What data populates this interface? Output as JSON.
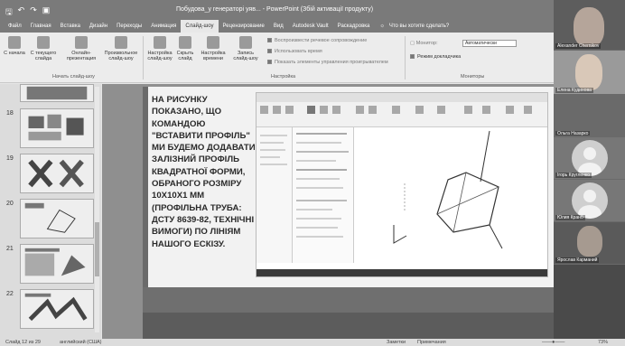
{
  "window": {
    "title": "Побудова_у генераторі уяв... - PowerPoint (Збій активації продукту)"
  },
  "tabs": [
    "Файл",
    "Главная",
    "Вставка",
    "Дизайн",
    "Переходы",
    "Анимация",
    "Слайд-шоу",
    "Рецензирование",
    "Вид",
    "Autodesk Vault",
    "Раскадровка"
  ],
  "active_tab": "Слайд-шоу",
  "help_text": "Что вы хотите сделать?",
  "ribbon": {
    "btn_from_start": "С начала",
    "btn_current": "С текущего слайда",
    "btn_online": "Онлайн-презентация",
    "btn_custom": "Произвольное слайд-шоу",
    "group_start": "Начать слайд-шоу",
    "btn_setup": "Настройка слайд-шоу",
    "btn_hide": "Скрыть слайд",
    "btn_timing": "Настройка времени",
    "btn_record": "Запись слайд-шоу",
    "chk_narration": "Воспроизвести речевое сопровождение",
    "chk_timings": "Использовать время",
    "chk_controls": "Показать элементы управления проигрывателем",
    "group_setup": "Настройка",
    "monitor_label": "Монитор:",
    "monitor_value": "Автоматически",
    "presenter_view": "Режим докладчика",
    "group_monitors": "Мониторы"
  },
  "thumbnails": [
    "18",
    "19",
    "20",
    "21",
    "22"
  ],
  "slide": {
    "text": "НА РИСУНКУ ПОКАЗАНО, ЩО КОМАНДОЮ \"ВСТАВИТИ ПРОФІЛЬ\" МИ БУДЕМО ДОДАВАТИ ЗАЛІЗНИЙ ПРОФІЛЬ КВАДРАТНОЇ ФОРМИ, ОБРАНОГО РОЗМІРУ 10Х10Х1 ММ (ПРОФІЛЬНА ТРУБА: ДСТУ 8639-82, ТЕХНІЧНІ ВИМОГИ) ПО ЛІНІЯМ НАШОГО ЕСКІЗУ."
  },
  "status": {
    "slide_info": "Слайд 12 из 29",
    "language": "английский (США)",
    "notes": "Заметки",
    "comments": "Примечания",
    "zoom": "73%"
  },
  "participants": [
    "Alexander Chernikov",
    "Елена Кудинова",
    "Ольга Назарко",
    "Ігорь Кругленко",
    "Юлия Кранб",
    "Ярослав Карманий"
  ]
}
